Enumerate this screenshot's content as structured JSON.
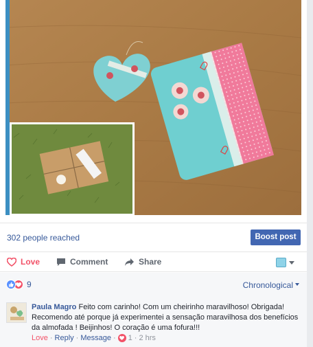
{
  "reach": {
    "text": "302 people reached"
  },
  "boost": {
    "label": "Boost post"
  },
  "actions": {
    "love": "Love",
    "comment": "Comment",
    "share": "Share"
  },
  "audience_icon": "page-audience-icon",
  "reactions": {
    "count": "9",
    "icons": [
      "like",
      "love"
    ]
  },
  "sort": {
    "label": "Chronological"
  },
  "comment": {
    "author": "Paula Magro",
    "text": "Feito com carinho! Com um cheirinho maravilhoso! Obrigada! Recomendo até porque já experimentei a sensação maravilhosa dos benefícios da almofada ! Beijinhos! O coração é uma fofura!!!",
    "love": "Love",
    "reply": "Reply",
    "message": "Message",
    "reaction_count": "1",
    "time": "2 hrs",
    "separator": "·"
  },
  "colors": {
    "link": "#365899",
    "love": "#f25268",
    "boost": "#4267b2",
    "muted": "#90949c"
  }
}
